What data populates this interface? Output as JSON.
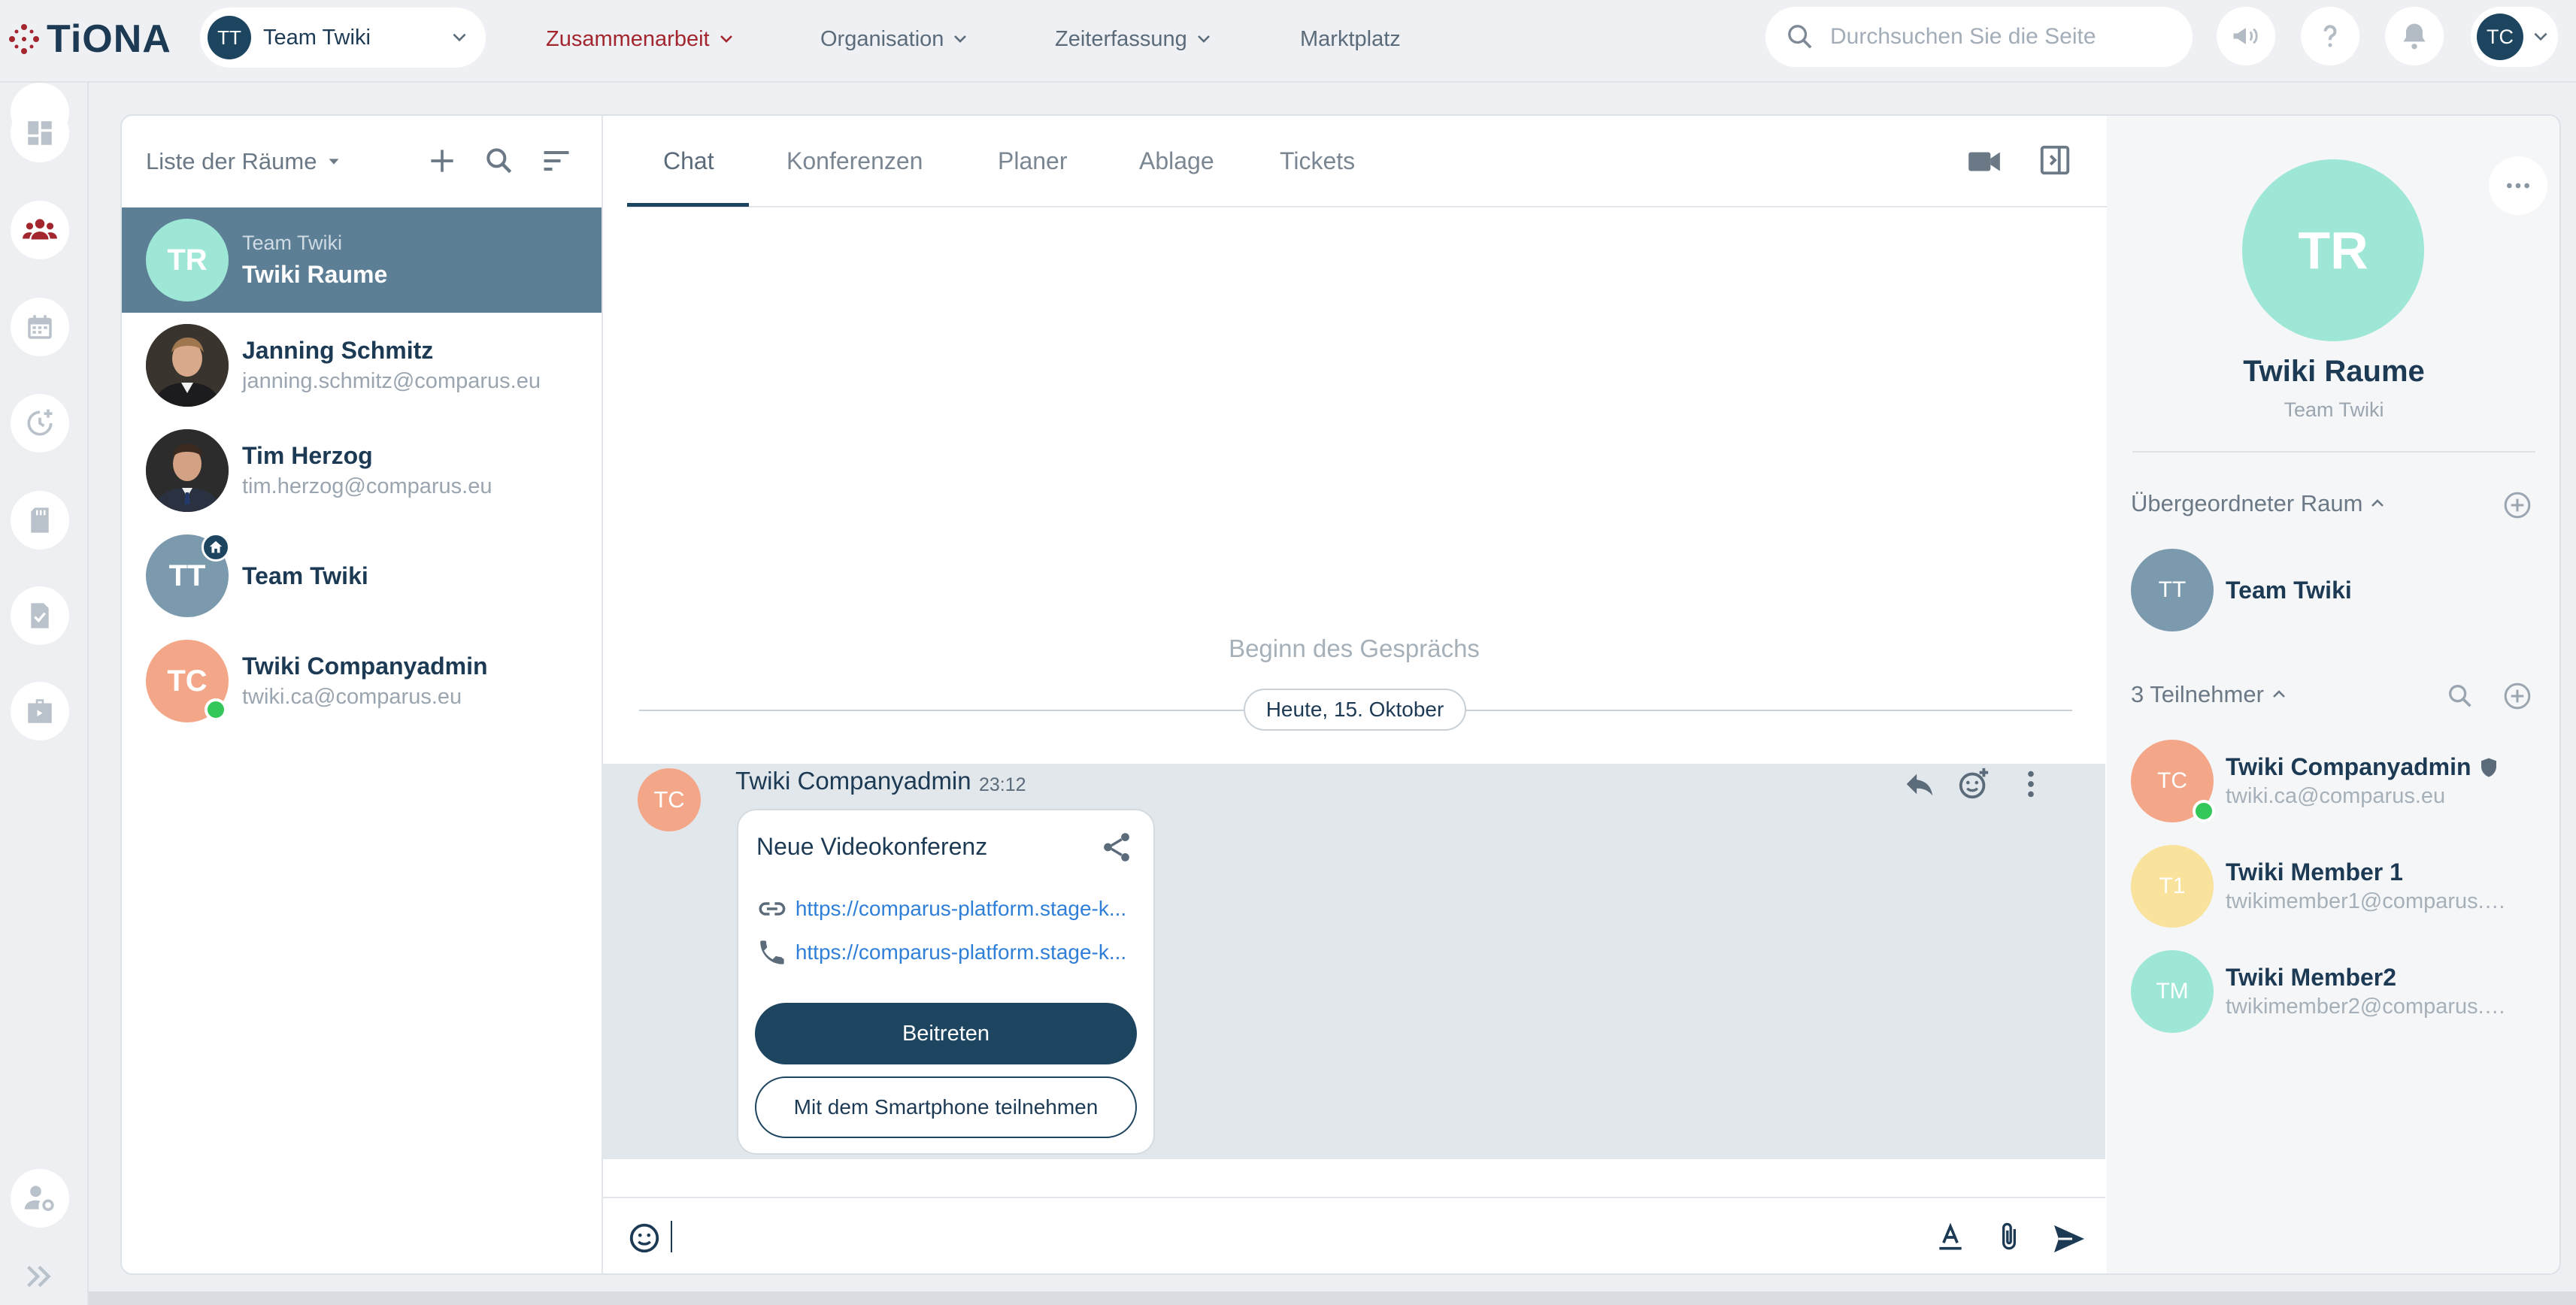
{
  "app": {
    "logo_text": "TiONA"
  },
  "header": {
    "team_select": {
      "avatar": "TT",
      "label": "Team Twiki"
    },
    "nav": [
      {
        "label": "Zusammenarbeit",
        "active": true
      },
      {
        "label": "Organisation"
      },
      {
        "label": "Zeiterfassung"
      },
      {
        "label": "Marktplatz"
      }
    ],
    "search_placeholder": "Durchsuchen Sie die Seite",
    "user_avatar": "TC"
  },
  "rail": [
    "dashboard-icon",
    "team-icon",
    "calendar-icon",
    "time-tracking-icon",
    "document-icon",
    "task-icon",
    "briefcase-icon",
    "user-settings-icon",
    "expand-icon"
  ],
  "rooms": {
    "header_title": "Liste der Räume",
    "items": [
      {
        "avatar": "TR",
        "pre": "Team Twiki",
        "name": "Twiki Raume",
        "sub": ""
      },
      {
        "avatar": "",
        "name": "Janning Schmitz",
        "sub": "janning.schmitz@comparus.eu"
      },
      {
        "avatar": "",
        "name": "Tim Herzog",
        "sub": "tim.herzog@comparus.eu"
      },
      {
        "avatar": "TT",
        "name": "Team Twiki",
        "sub": ""
      },
      {
        "avatar": "TC",
        "name": "Twiki Companyadmin",
        "sub": "twiki.ca@comparus.eu"
      }
    ]
  },
  "chat": {
    "tabs": [
      "Chat",
      "Konferenzen",
      "Planer",
      "Ablage",
      "Tickets"
    ],
    "conversation_start": "Beginn des Gesprächs",
    "date_divider": "Heute, 15. Oktober",
    "message": {
      "avatar": "TC",
      "sender": "Twiki Companyadmin",
      "time": "23:12",
      "card": {
        "title": "Neue Videokonferenz",
        "link1": "https://comparus-platform.stage-k...",
        "link2": "https://comparus-platform.stage-k...",
        "join_label": "Beitreten",
        "phone_label": "Mit dem Smartphone teilnehmen"
      }
    }
  },
  "details": {
    "avatar": "TR",
    "room_name": "Twiki Raume",
    "team_name": "Team Twiki",
    "parent_header": "Übergeordneter Raum",
    "parent": {
      "avatar": "TT",
      "name": "Team Twiki"
    },
    "participants_header": "3 Teilnehmer",
    "participants": [
      {
        "avatar": "TC",
        "name": "Twiki Companyadmin",
        "email": "twiki.ca@comparus.eu"
      },
      {
        "avatar": "T1",
        "name": "Twiki Member 1",
        "email": "twikimember1@comparus.c..."
      },
      {
        "avatar": "TM",
        "name": "Twiki Member2",
        "email": "twikimember2@comparus.c..."
      }
    ]
  },
  "colors": {
    "primary": "#1d4560",
    "accent": "#a3262e",
    "link": "#2f7fd8",
    "online": "#34c759"
  }
}
